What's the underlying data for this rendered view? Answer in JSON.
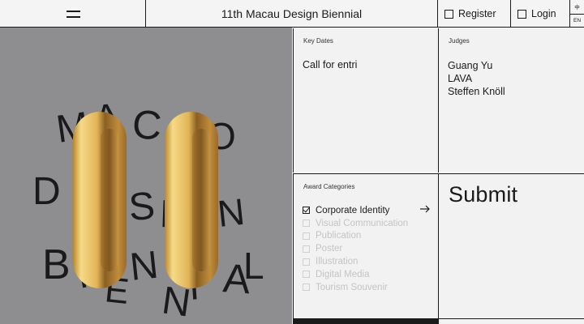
{
  "header": {
    "title": "11th Macau Design Biennial",
    "register_label": "Register",
    "login_label": "Login",
    "lang_zh": "中",
    "lang_en": "EN"
  },
  "hero": {
    "background": "#8e8e90",
    "letters": [
      {
        "char": "M"
      },
      {
        "char": "A"
      },
      {
        "char": "C"
      },
      {
        "char": "A"
      },
      {
        "char": "O"
      },
      {
        "char": "D"
      },
      {
        "char": "E"
      },
      {
        "char": "S"
      },
      {
        "char": "I"
      },
      {
        "char": "G"
      },
      {
        "char": "N"
      },
      {
        "char": "B"
      },
      {
        "char": "I"
      },
      {
        "char": "E"
      },
      {
        "char": "N"
      },
      {
        "char": "N"
      },
      {
        "char": "I"
      },
      {
        "char": "A"
      },
      {
        "char": "L"
      }
    ]
  },
  "key_dates": {
    "label": "Key Dates",
    "text": "Call for entri"
  },
  "judges": {
    "label": "Judges",
    "names": [
      "Guang Yu",
      "LAVA",
      "Steffen Knöll"
    ]
  },
  "awards": {
    "label": "Award Categories",
    "items": [
      {
        "label": "Corporate Identity",
        "checked": true
      },
      {
        "label": "Visual Communication",
        "checked": false
      },
      {
        "label": "Publication",
        "checked": false
      },
      {
        "label": "Poster",
        "checked": false
      },
      {
        "label": "Illustration",
        "checked": false
      },
      {
        "label": "Digital Media",
        "checked": false
      },
      {
        "label": "Tourism Souvenir",
        "checked": false
      }
    ]
  },
  "submit": {
    "label": "Submit"
  },
  "icons": {
    "menu": "hamburger-menu-icon",
    "arrow": "arrow-right-icon"
  }
}
